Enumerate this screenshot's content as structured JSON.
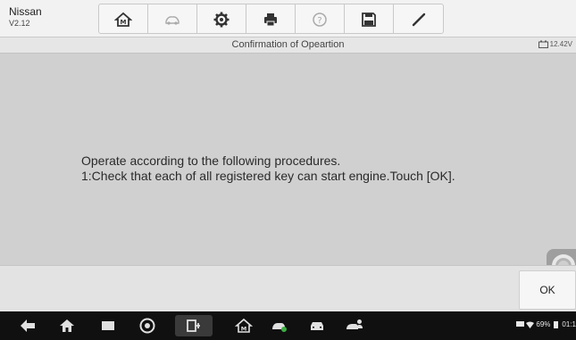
{
  "header": {
    "make": "Nissan",
    "version": "V2.12",
    "tools": [
      {
        "name": "home-icon"
      },
      {
        "name": "vehicle-swap-icon"
      },
      {
        "name": "settings-gear-icon"
      },
      {
        "name": "print-icon"
      },
      {
        "name": "help-icon"
      },
      {
        "name": "save-icon"
      },
      {
        "name": "edit-icon"
      }
    ]
  },
  "titlebar": {
    "title": "Confirmation of Opeartion",
    "battery_voltage": "12.42V"
  },
  "message": {
    "line1": "Operate according to the following procedures.",
    "line2": "1:Check that each of all registered key can start engine.Touch [OK]."
  },
  "actions": {
    "ok_label": "OK"
  },
  "navbar": {
    "status_battery": "69%",
    "time": "01:1"
  },
  "colors": {
    "toolbar_bg": "#f2f2f2",
    "content_bg": "#d0d0d0",
    "navbar_bg": "#101010"
  }
}
